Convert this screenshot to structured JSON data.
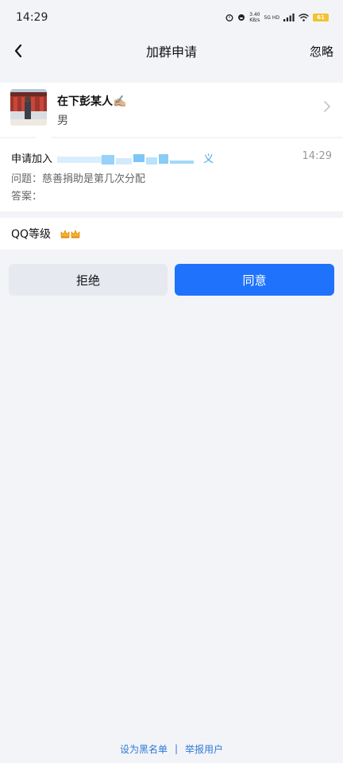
{
  "status_bar": {
    "time": "14:29",
    "speed_value": "3.40",
    "speed_unit": "KB/s",
    "network": "5G HD",
    "battery": "61"
  },
  "nav": {
    "title": "加群申请",
    "ignore_label": "忽略"
  },
  "user": {
    "name": "在下彭某人✍🏼",
    "gender": "男"
  },
  "request": {
    "join_label": "申请加入",
    "group_name_visible_end": "义",
    "time": "14:29",
    "question": "问题：慈善捐助是第几次分配",
    "answer": "答案："
  },
  "level": {
    "label": "QQ等级",
    "crown_icon": "crown-icon",
    "crown_count": 2
  },
  "actions": {
    "reject_label": "拒绝",
    "accept_label": "同意"
  },
  "footer": {
    "blacklist_label": "设为黑名单",
    "separator": "|",
    "report_label": "举报用户"
  },
  "colors": {
    "accent": "#1f72fb",
    "link": "#2d7ad6",
    "group_name": "#3aa3f5",
    "background": "#f3f4f8"
  }
}
